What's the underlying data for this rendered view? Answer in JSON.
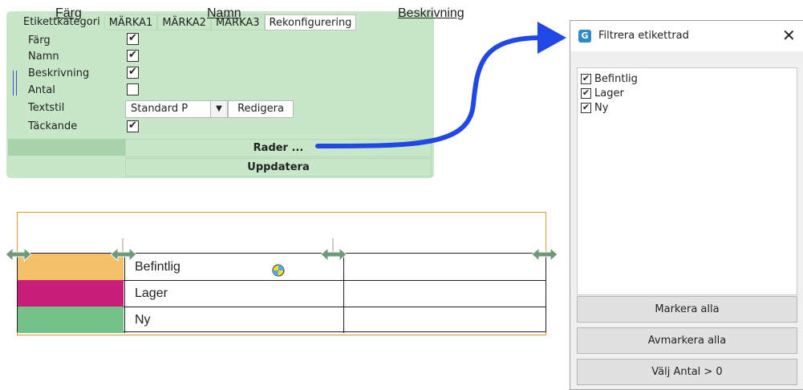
{
  "config_panel": {
    "tabs": [
      {
        "label": "Etikettkategori",
        "active": false
      },
      {
        "label": "MÄRKA1",
        "active": false
      },
      {
        "label": "MÄRKA2",
        "active": false
      },
      {
        "label": "MÄRKA3",
        "active": false
      },
      {
        "label": "Rekonfigurering",
        "active": true
      }
    ],
    "properties": [
      {
        "label": "Färg",
        "checked": true
      },
      {
        "label": "Namn",
        "checked": true
      },
      {
        "label": "Beskrivning",
        "checked": true
      },
      {
        "label": "Antal",
        "checked": false
      },
      {
        "label": "Textstil",
        "control": "select"
      },
      {
        "label": "Täckande",
        "checked": true
      }
    ],
    "textstyle_value": "Standard P",
    "edit_label": "Redigera",
    "rows_button": "Rader ...",
    "update_button": "Uppdatera",
    "check_glyph": "✔"
  },
  "label_table": {
    "headers": [
      "Färg",
      "Namn",
      "Beskrivning"
    ],
    "rows": [
      {
        "name": "Befintlig",
        "color": "#f4c06a"
      },
      {
        "name": "Lager",
        "color": "#c81e78"
      },
      {
        "name": "Ny",
        "color": "#73c389"
      }
    ]
  },
  "filter_dialog": {
    "title": "Filtrera etikettrad",
    "close_glyph": "✕",
    "logo_glyph": "G",
    "items": [
      {
        "label": "Befintlig",
        "checked": true
      },
      {
        "label": "Lager",
        "checked": true
      },
      {
        "label": "Ny",
        "checked": true
      }
    ],
    "buttons": [
      "Markera alla",
      "Avmarkera alla",
      "Välj Antal > 0"
    ]
  },
  "colors": {
    "arrow": "#1f48e6",
    "panel": "#c8e6c8",
    "resizer": "#6d9b79"
  }
}
